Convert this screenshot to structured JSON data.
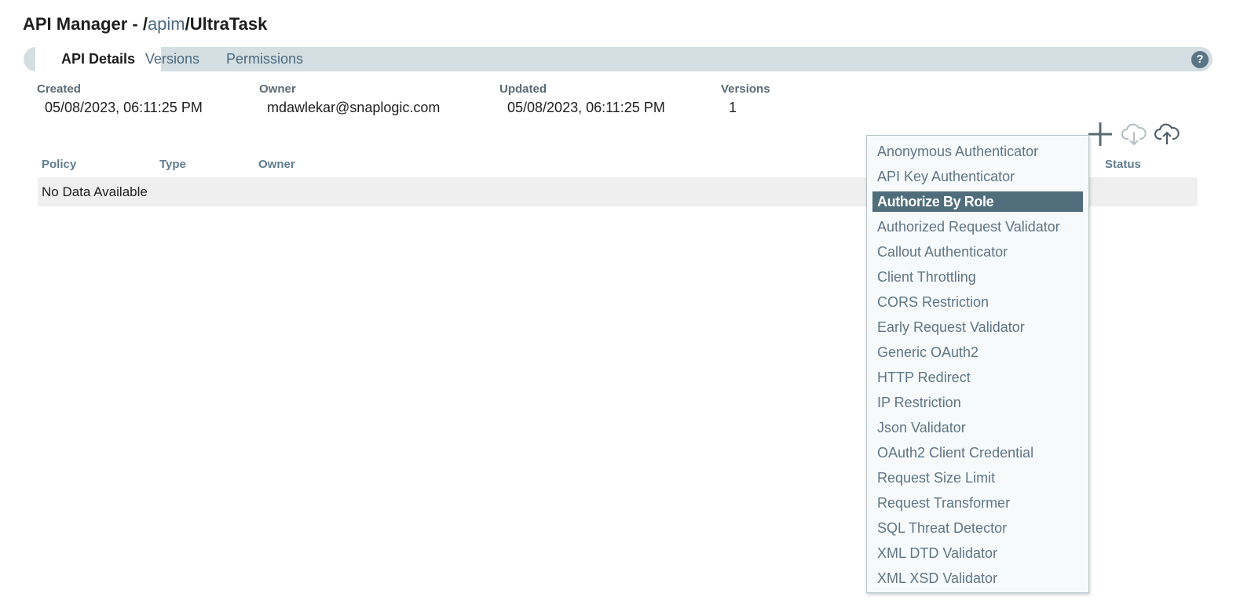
{
  "header": {
    "title_prefix": "API Manager - ",
    "path_separator_1": "/",
    "path_link": "apim",
    "path_separator_2": "/",
    "api_name": "UltraTask"
  },
  "tabs": [
    {
      "label": "API Details",
      "active": true
    },
    {
      "label": "Versions",
      "active": false
    },
    {
      "label": "Permissions",
      "active": false
    }
  ],
  "help_icon": {
    "glyph": "?",
    "icon": "help-icon"
  },
  "details": {
    "created_label": "Created",
    "created_value": "05/08/2023, 06:11:25 PM",
    "owner_label": "Owner",
    "owner_value": "mdawlekar@snaplogic.com",
    "updated_label": "Updated",
    "updated_value": "05/08/2023, 06:11:25 PM",
    "versions_label": "Versions",
    "versions_value": "1"
  },
  "toolbar_icons": [
    "plus-icon",
    "cloud-download-icon",
    "cloud-upload-icon"
  ],
  "policy_table": {
    "columns": [
      "Policy",
      "Type",
      "Owner",
      "Status"
    ],
    "empty_text": "No Data Available"
  },
  "policy_dropdown": {
    "items": [
      "Anonymous Authenticator",
      "API Key Authenticator",
      "Authorize By Role",
      "Authorized Request Validator",
      "Callout Authenticator",
      "Client Throttling",
      "CORS Restriction",
      "Early Request Validator",
      "Generic OAuth2",
      "HTTP Redirect",
      "IP Restriction",
      "Json Validator",
      "OAuth2 Client Credential",
      "Request Size Limit",
      "Request Transformer",
      "SQL Threat Detector",
      "XML DTD Validator",
      "XML XSD Validator"
    ],
    "selected": "Authorize By Role"
  },
  "colors": {
    "accent": "#506d7c",
    "tab_bar": "#d5dee2",
    "link": "#4a6a80",
    "column_header": "#5f7d8f"
  }
}
